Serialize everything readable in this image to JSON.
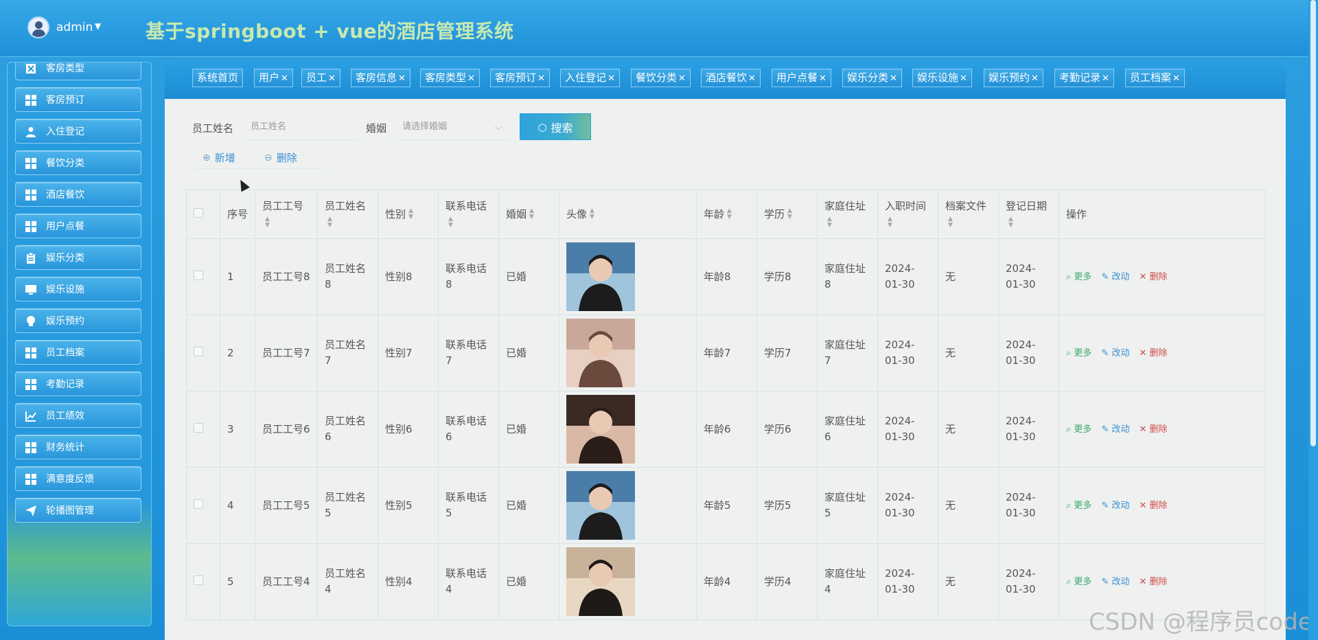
{
  "header": {
    "user": "admin",
    "title": "基于springboot + vue的酒店管理系统"
  },
  "sidebar": {
    "items": [
      {
        "label": "客房类型",
        "icon": "close-square-icon"
      },
      {
        "label": "客房预订",
        "icon": "grid-icon"
      },
      {
        "label": "入住登记",
        "icon": "user-icon"
      },
      {
        "label": "餐饮分类",
        "icon": "grid-icon"
      },
      {
        "label": "酒店餐饮",
        "icon": "grid-icon"
      },
      {
        "label": "用户点餐",
        "icon": "grid-icon"
      },
      {
        "label": "娱乐分类",
        "icon": "clipboard-icon"
      },
      {
        "label": "娱乐设施",
        "icon": "monitor-icon"
      },
      {
        "label": "娱乐预约",
        "icon": "bulb-icon"
      },
      {
        "label": "员工档案",
        "icon": "grid-icon"
      },
      {
        "label": "考勤记录",
        "icon": "grid-icon"
      },
      {
        "label": "员工绩效",
        "icon": "chart-icon"
      },
      {
        "label": "财务统计",
        "icon": "grid-icon"
      },
      {
        "label": "满意度反馈",
        "icon": "grid-icon"
      },
      {
        "label": "轮播图管理",
        "icon": "send-icon"
      }
    ]
  },
  "tabs": [
    {
      "label": "系统首页",
      "closable": false
    },
    {
      "label": "用户",
      "closable": true
    },
    {
      "label": "员工",
      "closable": true
    },
    {
      "label": "客房信息",
      "closable": true
    },
    {
      "label": "客房类型",
      "closable": true
    },
    {
      "label": "客房预订",
      "closable": true
    },
    {
      "label": "入住登记",
      "closable": true
    },
    {
      "label": "餐饮分类",
      "closable": true
    },
    {
      "label": "酒店餐饮",
      "closable": true
    },
    {
      "label": "用户点餐",
      "closable": true
    },
    {
      "label": "娱乐分类",
      "closable": true
    },
    {
      "label": "娱乐设施",
      "closable": true
    },
    {
      "label": "娱乐预约",
      "closable": true
    },
    {
      "label": "考勤记录",
      "closable": true
    },
    {
      "label": "员工档案",
      "closable": true
    }
  ],
  "tab_close_glyph": "✕",
  "search": {
    "name_label": "员工姓名",
    "name_placeholder": "员工姓名",
    "marriage_label": "婚姻",
    "marriage_placeholder": "请选择婚姻",
    "button": "搜索"
  },
  "actions": {
    "add": "新增",
    "delete": "删除"
  },
  "table": {
    "columns": {
      "index": "序号",
      "emp_no": "员工工号",
      "emp_name": "员工姓名",
      "gender": "性别",
      "phone": "联系电话",
      "marriage": "婚姻",
      "avatar": "头像",
      "age": "年龄",
      "education": "学历",
      "address": "家庭住址",
      "join_date": "入职时间",
      "file": "档案文件",
      "reg_date": "登记日期",
      "ops": "操作"
    },
    "op_labels": {
      "more": "更多",
      "edit": "改动",
      "delete": "删除"
    },
    "rows": [
      {
        "index": "1",
        "emp_no": "员工工号8",
        "emp_name": "员工姓名8",
        "gender": "性别8",
        "phone": "联系电话8",
        "marriage": "已婚",
        "age": "年龄8",
        "education": "学历8",
        "address": "家庭住址8",
        "join_date": "2024-01-30",
        "file": "无",
        "reg_date": "2024-01-30"
      },
      {
        "index": "2",
        "emp_no": "员工工号7",
        "emp_name": "员工姓名7",
        "gender": "性别7",
        "phone": "联系电话7",
        "marriage": "已婚",
        "age": "年龄7",
        "education": "学历7",
        "address": "家庭住址7",
        "join_date": "2024-01-30",
        "file": "无",
        "reg_date": "2024-01-30"
      },
      {
        "index": "3",
        "emp_no": "员工工号6",
        "emp_name": "员工姓名6",
        "gender": "性别6",
        "phone": "联系电话6",
        "marriage": "已婚",
        "age": "年龄6",
        "education": "学历6",
        "address": "家庭住址6",
        "join_date": "2024-01-30",
        "file": "无",
        "reg_date": "2024-01-30"
      },
      {
        "index": "4",
        "emp_no": "员工工号5",
        "emp_name": "员工姓名5",
        "gender": "性别5",
        "phone": "联系电话5",
        "marriage": "已婚",
        "age": "年龄5",
        "education": "学历5",
        "address": "家庭住址5",
        "join_date": "2024-01-30",
        "file": "无",
        "reg_date": "2024-01-30"
      },
      {
        "index": "5",
        "emp_no": "员工工号4",
        "emp_name": "员工姓名4",
        "gender": "性别4",
        "phone": "联系电话4",
        "marriage": "已婚",
        "age": "年龄4",
        "education": "学历4",
        "address": "家庭住址4",
        "join_date": "2024-01-30",
        "file": "无",
        "reg_date": "2024-01-30"
      }
    ]
  },
  "watermark": "CSDN @程序员code"
}
